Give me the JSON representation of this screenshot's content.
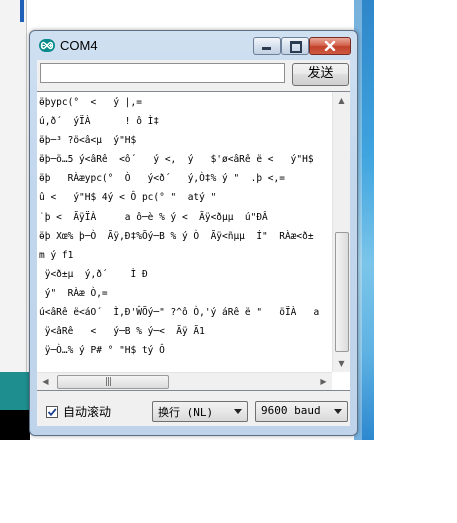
{
  "window": {
    "title": "COM4",
    "app_icon": "arduino-infinity-icon"
  },
  "controls": {
    "minimize_icon": "minimize-icon",
    "maximize_icon": "maximize-icon",
    "close_icon": "close-icon"
  },
  "input": {
    "value": "",
    "send_label": "发送"
  },
  "output": {
    "lines": [
      "ӫþypc(°  <   ý |,=",
      "ú,ð´  ýÏÀ      ! ô Ì‡",
      "ӫþ─³ ?ö<â<µ  ý\"H$",
      "ӫþ─ö…5 ý<âRê  <ô´   ý <,  ý   $'ø<âRê ë <   ý\"H$",
      "ӫþ   RÀæypc(°  Ò   ý<ð´   ý,Ò‡% ý \"  .þ <,=",
      "û <   ý\"H$ 4ý < Ô pc(° \"  atý \"",
      "˙þ <  ÃÿÏÀ     a ô─è % ý <  Ãÿ<ðµµ  ú\"ÐÂ",
      "ӫþ Xœ% þ─Ò  Ãÿ,Ð‡%Õý─B % ý Ò  Ãÿ<ñµµ  Í\"  RÀæ<ð±",
      "m ý f1",
      " ÿ<ð±µ  ý,ð´    Ì Ð",
      " ý\"  RÀæ Ò,=",
      "ú<âRê ë<áO´  Ì,Ð'ŴÕý─\" ?^ô Ò,'ý áRê ë \"   öÏÀ   a",
      " ÿ<âRê   <   ý─B % ý─<  Ãÿ Ã1",
      " ÿ─Ò…% ý P# ° \"H$ tý Ô",
      "°"
    ]
  },
  "footer": {
    "autoscroll_label": "自动滚动",
    "autoscroll_checked": true,
    "line_ending": "换行 (NL)",
    "baud": "9600 baud"
  }
}
